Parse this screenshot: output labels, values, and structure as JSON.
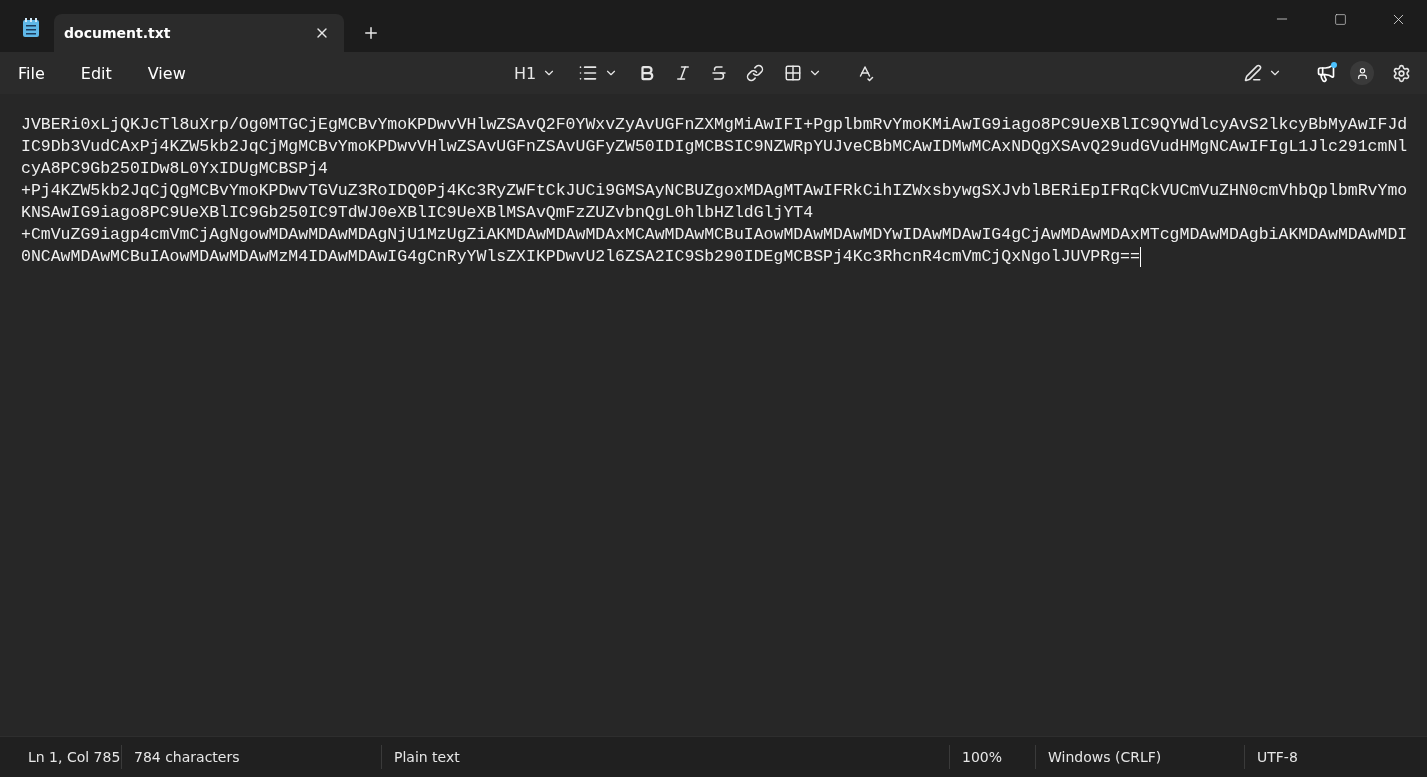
{
  "tabs": [
    {
      "label": "document.txt",
      "selected": true
    }
  ],
  "menu": [
    "File",
    "Edit",
    "View"
  ],
  "toolbar": {
    "heading": "H1"
  },
  "editor": {
    "lines": [
      "JVBERi0xLjQKJcTl8uXrp/Og0MTGCjEgMCBvYmoKPDwvVHlwZSAvQ2F0YWxvZyAvUGFnZXMgMiAwIFI+PgplbmRvYmoKMiAwIG9iago8PC9UeXBlIC9QYWdlcyAvS2lkcyBbMyAwIFJd",
      "IC9Db3VudCAxPj4KZW5kb2JqCjMgMCBvYmoKPDwvVHlwZSAvUGFnZSAvUGFyZW50IDIgMCBSIC9NZWRpYUJveCBbMCAwIDMwMCAxNDQgXSAvQ29udGVudHMgNCAwIFIgL1Jlc291cmNl",
      "cyA8PC9Gb250IDw8L0YxIDUgMCBSPj4",
      "+Pj4KZW5kb2JqCjQgMCBvYmoKPDwvTGVuZ3RoIDQ0Pj4Kc3RyZWFtCkJUCi9GMSAyNCBUZgoxMDAgMTAwIFRkCihIZWxsbywgSXJvblBERiEpIFRqCkVUCmVuZHN0cmVhbQplbmRvYmo",
      "KNSAwIG9iago8PC9UeXBlIC9Gb250IC9TdWJ0eXBlIC9UeXBlMSAvQmFzZUZvbnQgL0hlbHZldGljYT4",
      "+CmVuZG9iagp4cmVmCjAgNgowMDAwMDAwMDAgNjU1MzUgZiAKMDAwMDAwMDAxMCAwMDAwMCBuIAowMDAwMDAwMDYwIDAwMDAwIG4gCjAwMDAwMDAxMTcgMDAwMDAgbiAKMDAwMDAwMDI",
      "0NCAwMDAwMCBuIAowMDAwMDAwMzM4IDAwMDAwIG4gCnRyYWlsZXIKPDwvU2l6ZSA2IC9Sb290IDEgMCBSPj4Kc3RhcnR4cmVmCjQxNgolJUVPRg=="
    ]
  },
  "status_bar": [
    "Ln 1, Col 785",
    "784 characters",
    "Plain text",
    "100%",
    "Windows (CRLF)",
    "UTF-8"
  ]
}
